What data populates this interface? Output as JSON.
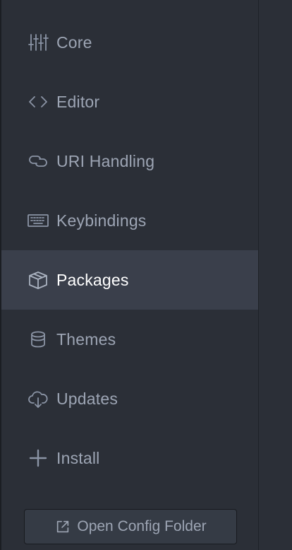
{
  "sidebar": {
    "items": [
      {
        "label": "Core",
        "icon": "sliders-icon",
        "active": false
      },
      {
        "label": "Editor",
        "icon": "code-icon",
        "active": false
      },
      {
        "label": "URI Handling",
        "icon": "link-icon",
        "active": false
      },
      {
        "label": "Keybindings",
        "icon": "keyboard-icon",
        "active": false
      },
      {
        "label": "Packages",
        "icon": "package-icon",
        "active": true
      },
      {
        "label": "Themes",
        "icon": "paintcan-icon",
        "active": false
      },
      {
        "label": "Updates",
        "icon": "cloud-download-icon",
        "active": false
      },
      {
        "label": "Install",
        "icon": "plus-icon",
        "active": false
      }
    ],
    "open_config_button": {
      "label": "Open Config Folder",
      "icon": "link-external-icon"
    }
  },
  "colors": {
    "sidebar_bg": "#2b2f37",
    "active_bg": "#3a3f4b",
    "text": "#9da5b4",
    "active_text": "#ffffff"
  }
}
